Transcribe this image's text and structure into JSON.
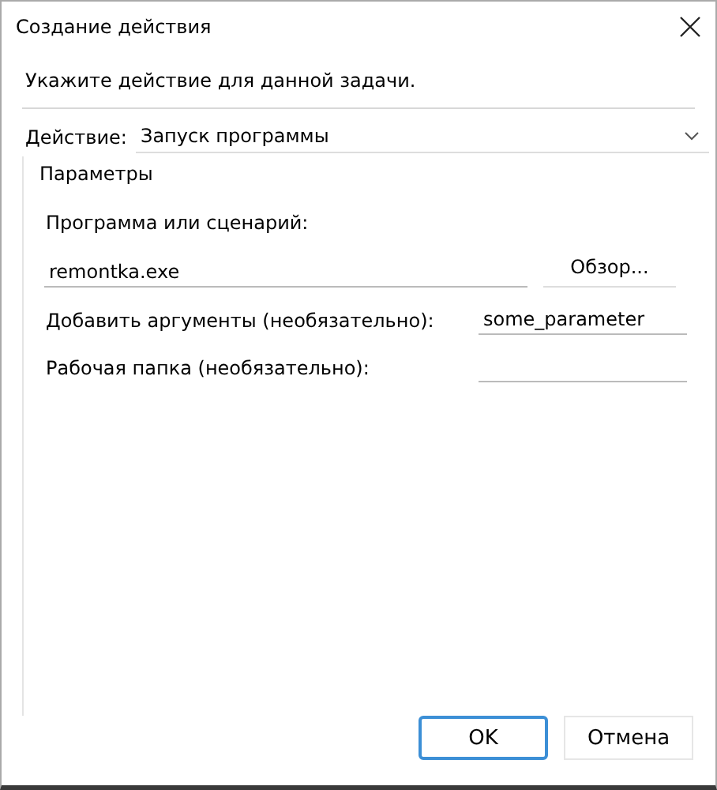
{
  "window": {
    "title": "Создание действия"
  },
  "instruction": "Укажите действие для данной задачи.",
  "action": {
    "label": "Действие:",
    "value": "Запуск программы"
  },
  "parameters": {
    "title": "Параметры",
    "program": {
      "label": "Программа или сценарий:",
      "value": "remontka.exe",
      "browse": "Обзор..."
    },
    "fields": [
      {
        "label": "Добавить аргументы (необязательно):",
        "value": "some_parameter"
      },
      {
        "label": "Рабочая папка (необязательно):"
      }
    ]
  },
  "buttons": [
    {
      "label": "OK",
      "selected": true
    },
    {
      "label": "Отмена",
      "selected": false
    }
  ]
}
